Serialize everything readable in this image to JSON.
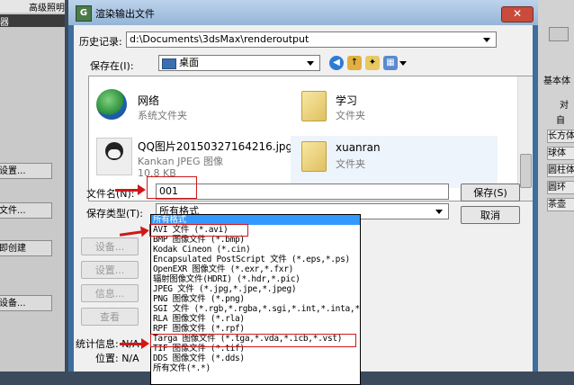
{
  "background_app": {
    "title_fragment": "高级照明",
    "panel_header": "器",
    "buttons": [
      "设置...",
      "文件...",
      "即创建",
      "设备..."
    ],
    "right_items": [
      "基本体",
      "对",
      "自",
      "长方体",
      "球体",
      "圆柱体",
      "圆环",
      "茶壶"
    ]
  },
  "dialog": {
    "title": "渲染输出文件",
    "history_label": "历史记录:",
    "history_value": "d:\\Documents\\3dsMax\\renderoutput",
    "savein_label": "保存在(I):",
    "savein_value": "桌面",
    "files": [
      {
        "name": "网络",
        "sub": "系统文件夹",
        "sub2": ""
      },
      {
        "name": "学习",
        "sub": "文件夹",
        "sub2": ""
      },
      {
        "name": "QQ图片20150327164216.jpg",
        "sub": "Kankan JPEG 图像",
        "sub2": "10.8 KB"
      },
      {
        "name": "xuanran",
        "sub": "文件夹",
        "sub2": ""
      }
    ],
    "filename_label": "文件名(N):",
    "filename_value": "001",
    "filetype_label": "保存类型(T):",
    "filetype_value": "所有格式",
    "save_button": "保存(S)",
    "cancel_button": "取消",
    "side_buttons": [
      "设备...",
      "设置...",
      "信息...",
      "查看"
    ],
    "stats_label": "统计信息: N/A",
    "location_label": "位置: N/A",
    "type_options": [
      "所有格式",
      "AVI 文件 (*.avi)",
      "BMP 图像文件 (*.bmp)",
      "Kodak Cineon (*.cin)",
      "Encapsulated PostScript 文件 (*.eps,*.ps)",
      "OpenEXR 图像文件 (*.exr,*.fxr)",
      "辐射图像文件(HDRI) (*.hdr,*.pic)",
      "JPEG 文件 (*.jpg,*.jpe,*.jpeg)",
      "PNG 图像文件 (*.png)",
      "SGI 文件 (*.rgb,*.rgba,*.sgi,*.int,*.inta,*.bw)",
      "RLA 图像文件 (*.rla)",
      "RPF 图像文件 (*.rpf)",
      "Targa 图像文件 (*.tga,*.vda,*.icb,*.vst)",
      "TIF 图像文件 (*.tif)",
      "DDS 图像文件 (*.dds)",
      "所有文件(*.*)"
    ]
  },
  "colors": {
    "annotation_red": "#d01818",
    "selection_blue": "#3399ff"
  }
}
